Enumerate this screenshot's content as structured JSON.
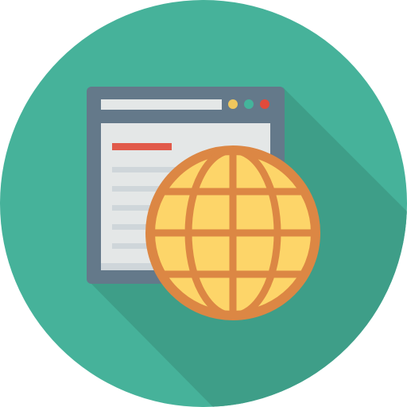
{
  "icon": {
    "name": "web-browser-globe-icon",
    "colors": {
      "background_circle": "#46B29A",
      "long_shadow": "#3E9E88",
      "browser_frame": "#64798A",
      "address_bar": "#E4E7E7",
      "dot_yellow": "#EFC75E",
      "dot_green": "#44B49B",
      "dot_red": "#E24B3B",
      "page": "#E4E7E7",
      "page_lines": "#CFD6DA",
      "page_heading": "#E15A4A",
      "globe_fill": "#FDD569",
      "globe_stroke": "#DC8744"
    }
  }
}
